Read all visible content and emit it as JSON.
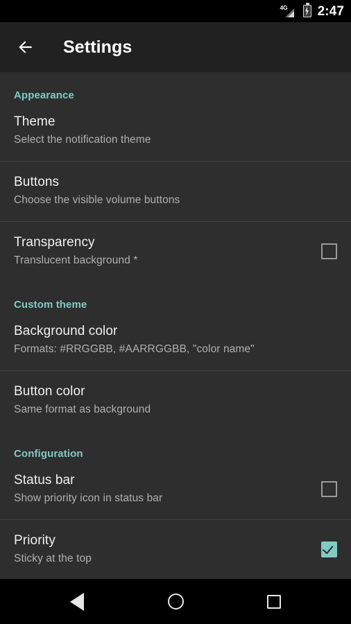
{
  "statusbar": {
    "network_label": "4G",
    "time": "2:47",
    "signal_icon": "signal-4g-icon",
    "battery_icon": "battery-charging-icon"
  },
  "toolbar": {
    "back_icon": "arrow-back-icon",
    "title": "Settings"
  },
  "colors": {
    "accent": "#80cbc4",
    "background": "#2e2e2e",
    "toolbar": "#212121",
    "divider": "#3f3f3f",
    "title_text": "#f0f0f0",
    "summary_text": "#b0b0b0"
  },
  "sections": [
    {
      "header": "Appearance",
      "rows": [
        {
          "title": "Theme",
          "summary": "Select the notification theme",
          "control": "none"
        },
        {
          "title": "Buttons",
          "summary": "Choose the visible volume buttons",
          "control": "none"
        },
        {
          "title": "Transparency",
          "summary": "Translucent background *",
          "control": "checkbox",
          "checked": false
        }
      ]
    },
    {
      "header": "Custom theme",
      "rows": [
        {
          "title": "Background color",
          "summary": "Formats: #RRGGBB, #AARRGGBB, \"color name\"",
          "control": "none"
        },
        {
          "title": "Button color",
          "summary": "Same format as background",
          "control": "none"
        }
      ]
    },
    {
      "header": "Configuration",
      "rows": [
        {
          "title": "Status bar",
          "summary": "Show priority icon in status bar",
          "control": "checkbox",
          "checked": false
        },
        {
          "title": "Priority",
          "summary": "Sticky at the top",
          "control": "checkbox",
          "checked": true
        }
      ]
    }
  ],
  "navbar": {
    "back": "nav-back-icon",
    "home": "nav-home-icon",
    "recents": "nav-recents-icon"
  }
}
